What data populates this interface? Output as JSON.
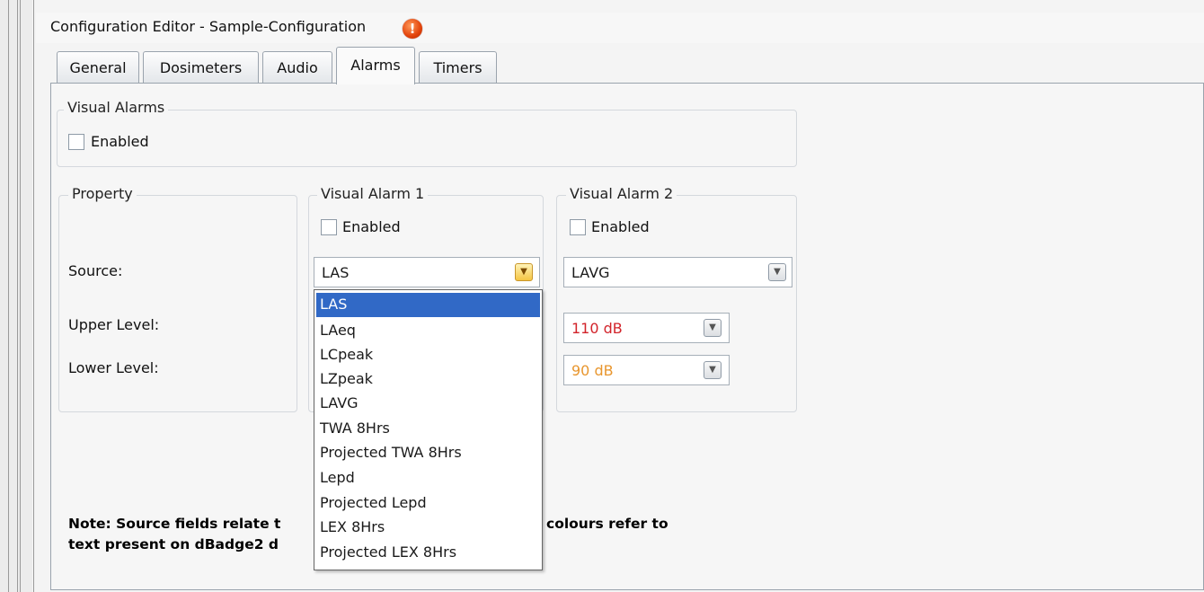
{
  "window": {
    "title": "Configuration Editor - Sample-Configuration",
    "warning_icon": "exclamation-icon"
  },
  "tabs": [
    "General",
    "Dosimeters",
    "Audio",
    "Alarms",
    "Timers"
  ],
  "active_tab": "Alarms",
  "visual_alarms": {
    "legend": "Visual Alarms",
    "enabled_label": "Enabled",
    "enabled": false
  },
  "property": {
    "legend": "Property",
    "source_label": "Source:",
    "upper_label": "Upper Level:",
    "lower_label": "Lower Level:"
  },
  "alarm1": {
    "legend": "Visual Alarm 1",
    "enabled_label": "Enabled",
    "enabled": false,
    "source": "LAS"
  },
  "alarm2": {
    "legend": "Visual Alarm 2",
    "enabled_label": "Enabled",
    "enabled": false,
    "source": "LAVG",
    "upper": "110 dB",
    "lower": "90 dB"
  },
  "dropdown_options": [
    "LAS",
    "LAeq",
    "LCpeak",
    "LZpeak",
    "LAVG",
    "TWA 8Hrs",
    "Projected TWA 8Hrs",
    "Lepd",
    "Projected Lepd",
    "LEX 8Hrs",
    "Projected LEX 8Hrs"
  ],
  "dropdown_selected": "LAS",
  "note": {
    "line1_a": "Note: Source fields relate t",
    "line1_b": "colours refer to",
    "line2": "text present on dBadge2 d"
  },
  "colors": {
    "upper_text": "#d2232a",
    "lower_text": "#e8962e",
    "selection": "#3169c6"
  }
}
